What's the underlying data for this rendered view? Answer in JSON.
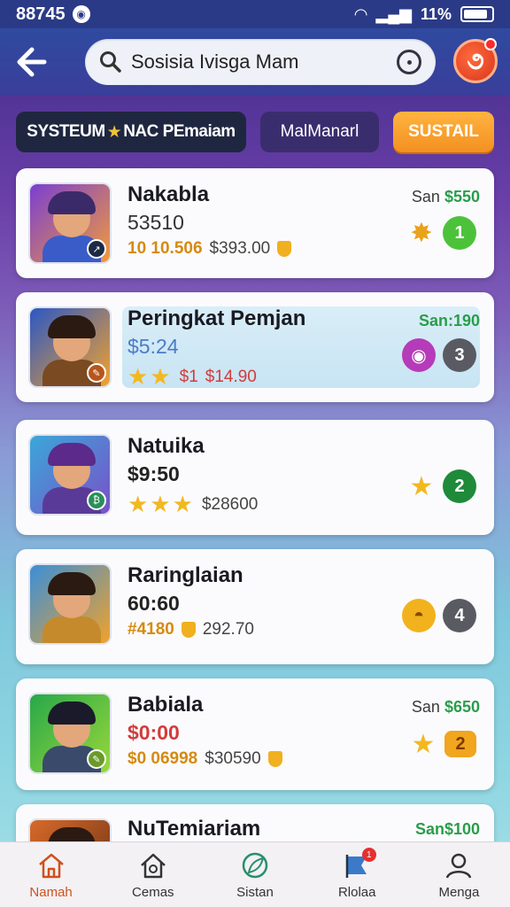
{
  "status": {
    "time": "88745",
    "battery": "11%"
  },
  "header": {
    "search_value": "Sosisia Ivisga Mam"
  },
  "tabs": [
    {
      "label_a": "SYSTEUM",
      "label_b": "NAC PEmaiam"
    },
    {
      "label": "MalManarl"
    },
    {
      "label": "SUSTAIL"
    }
  ],
  "cards": [
    {
      "title": "Nakabla",
      "line2": "53510",
      "line3a": "10 10.506",
      "line3b": "$393.00",
      "price_label": "San",
      "price_value": "$550",
      "rank": "1"
    },
    {
      "title": "Peringkat Pemjan",
      "line2": "$5:24",
      "line3a": "$1",
      "line3b": "$14.90",
      "price_label": "San",
      "price_value": ":190",
      "rank": "3"
    },
    {
      "title": "Natuika",
      "line2": "$9:50",
      "line3b": "$28600",
      "rank": "2"
    },
    {
      "title": "Raringlaian",
      "line2": "60:60",
      "line3a": "#4180",
      "line3b": "292.70",
      "rank": "4"
    },
    {
      "title": "Babiala",
      "line2": "$0:00",
      "line3a": "$0 06998",
      "line3b": "$30590",
      "price_label": "San",
      "price_value": "$650",
      "rank": "2"
    },
    {
      "title": "NuTemiariam",
      "price_label": "San",
      "price_value": "$100"
    }
  ],
  "nav": [
    {
      "label": "Namah",
      "icon": "home-icon"
    },
    {
      "label": "Cemas",
      "icon": "house-icon"
    },
    {
      "label": "Sistan",
      "icon": "leaf-icon"
    },
    {
      "label": "Rlolaa",
      "icon": "flag-icon",
      "badge": "1"
    },
    {
      "label": "Menga",
      "icon": "user-icon"
    }
  ],
  "colors": {
    "accent": "#f39020",
    "header": "#2f4aa0",
    "active_nav": "#d0501e"
  }
}
